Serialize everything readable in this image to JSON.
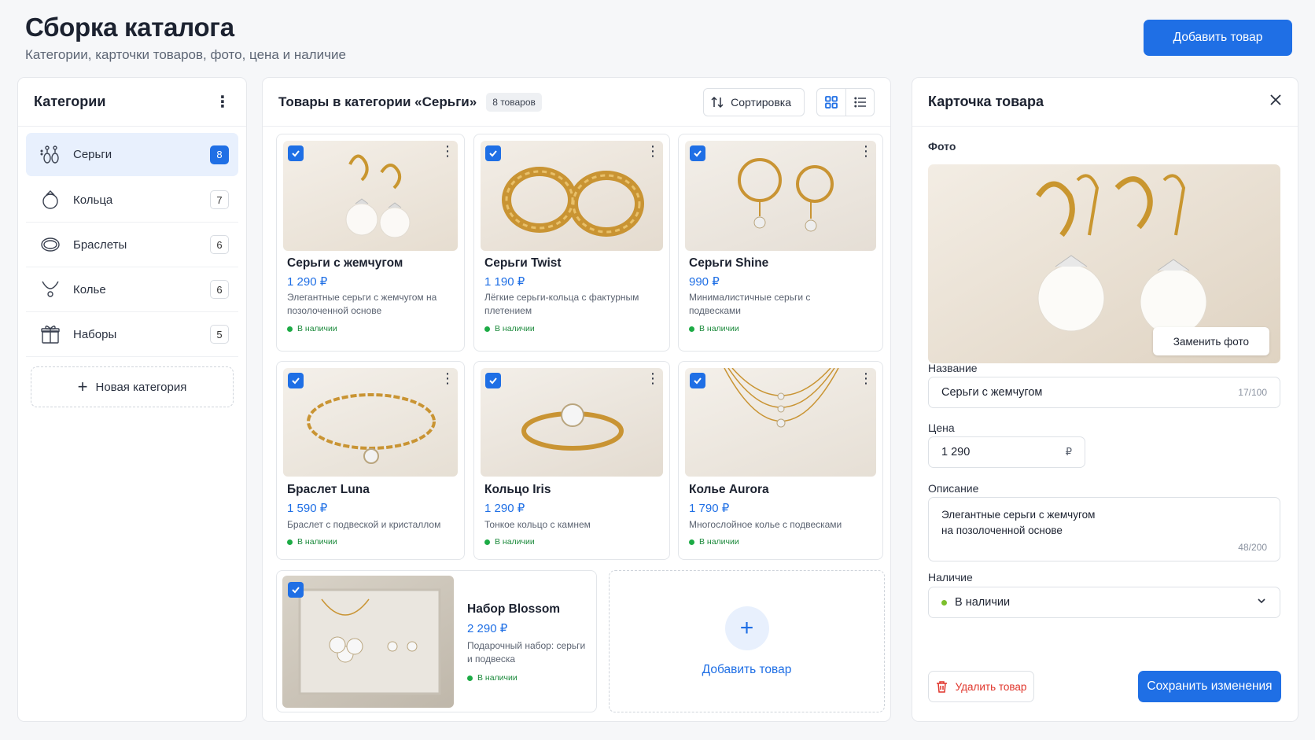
{
  "header": {
    "title": "Сборка каталога",
    "subtitle": "Категории, карточки товаров, фото, цена и наличие",
    "add_button": "Добавить товар"
  },
  "categories": {
    "title": "Категории",
    "items": [
      {
        "label": "Серьги",
        "count": "8",
        "icon": "earrings-icon",
        "active": true
      },
      {
        "label": "Кольца",
        "count": "7",
        "icon": "ring-icon"
      },
      {
        "label": "Браслеты",
        "count": "6",
        "icon": "bracelet-icon"
      },
      {
        "label": "Колье",
        "count": "6",
        "icon": "necklace-icon"
      },
      {
        "label": "Наборы",
        "count": "5",
        "icon": "gift-icon"
      }
    ],
    "new_category": "Новая категория"
  },
  "products": {
    "title": "Товары в категории «Серьги»",
    "count_badge": "8 товаров",
    "sort_label": "Сортировка",
    "items": [
      {
        "name": "Серьги с жемчугом",
        "price": "1 290 ₽",
        "desc": "Элегантные серьги с жемчугом на позолоченной основе",
        "stock": "В наличии"
      },
      {
        "name": "Серьги Twist",
        "price": "1 190 ₽",
        "desc": "Лёгкие серьги-кольца с фактурным плетением",
        "stock": "В наличии"
      },
      {
        "name": "Серьги Shine",
        "price": "990 ₽",
        "desc": "Минималистичные серьги с подвесками",
        "stock": "В наличии"
      },
      {
        "name": "Браслет Luna",
        "price": "1 590 ₽",
        "desc": "Браслет с подвеской и кристаллом",
        "stock": "В наличии"
      },
      {
        "name": "Кольцо Iris",
        "price": "1 290 ₽",
        "desc": "Тонкое кольцо с камнем",
        "stock": "В наличии"
      },
      {
        "name": "Колье Aurora",
        "price": "1 790 ₽",
        "desc": "Многослойное колье с подвесками",
        "stock": "В наличии"
      },
      {
        "name": "Набор Blossom",
        "price": "2 290 ₽",
        "desc": "Подарочный набор: серьги и подвеска",
        "stock": "В наличии"
      }
    ],
    "add_card_label": "Добавить товар"
  },
  "detail": {
    "title": "Карточка товара",
    "photo_label": "Фото",
    "replace_photo": "Заменить фото",
    "name_label": "Название",
    "name_value": "Серьги с жемчугом",
    "name_counter": "17/100",
    "price_label": "Цена",
    "price_value": "1 290",
    "currency": "₽",
    "desc_label": "Описание",
    "desc_value": "Элегантные серьги с жемчугом на позолоченной основе",
    "desc_counter": "48/200",
    "stock_label": "Наличие",
    "stock_value": "В наличии",
    "delete_button": "Удалить товар",
    "save_button": "Сохранить изменения"
  }
}
